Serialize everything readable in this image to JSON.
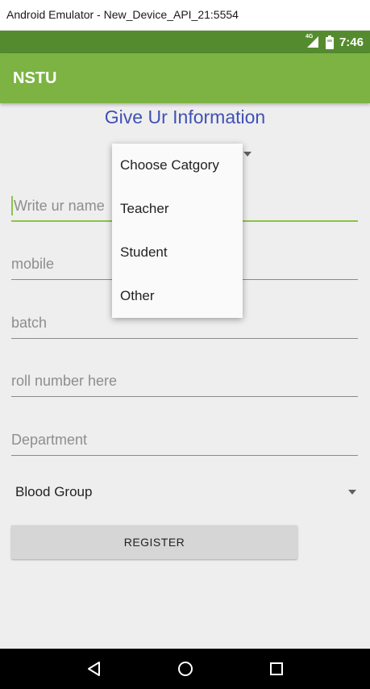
{
  "window": {
    "title": "Android Emulator - New_Device_API_21:5554"
  },
  "status_bar": {
    "network": "4G",
    "time": "7:46"
  },
  "app_bar": {
    "title": "NSTU"
  },
  "form": {
    "title": "Give Ur Information",
    "fields": {
      "name": {
        "placeholder": "Write ur name",
        "value": ""
      },
      "mobile": {
        "placeholder": "mobile",
        "value": ""
      },
      "batch": {
        "placeholder": "batch",
        "value": ""
      },
      "roll": {
        "placeholder": "roll number here",
        "value": ""
      },
      "department": {
        "placeholder": "Department",
        "value": ""
      }
    },
    "blood_group": {
      "selected": "Blood Group"
    },
    "register_label": "REGISTER"
  },
  "category_dropdown": {
    "options": [
      "Choose Catgory",
      "Teacher",
      "Student",
      "Other"
    ]
  },
  "colors": {
    "status_bar": "#558b2f",
    "app_bar": "#7cb342",
    "accent": "#8bc34a",
    "title_text": "#3f51b5"
  },
  "icons": {
    "nav": [
      "back-icon",
      "home-icon",
      "recents-icon"
    ]
  }
}
